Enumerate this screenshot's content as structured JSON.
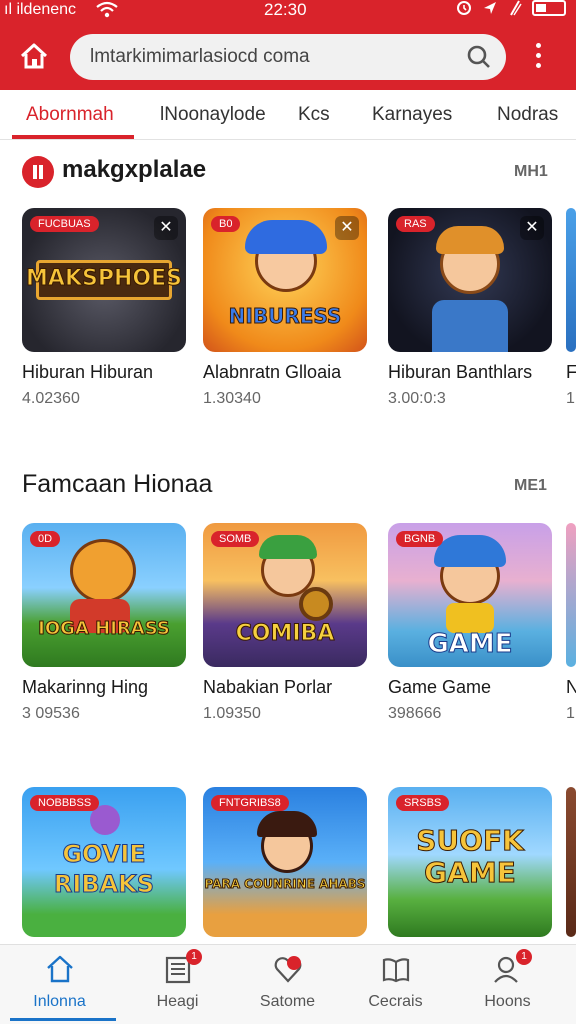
{
  "statusbar": {
    "carrier": "ıl ildenenc",
    "time": "22:30"
  },
  "browser": {
    "url": "lmtarkimimarlasiocd coma",
    "icons": [
      "home-icon",
      "search-icon",
      "more-vert-icon"
    ]
  },
  "tabs": [
    {
      "label": "Abornmah",
      "active": true
    },
    {
      "label": "lNoonaylode",
      "active": false
    },
    {
      "label": "Kcs",
      "active": false
    },
    {
      "label": "Karnayes",
      "active": false
    },
    {
      "label": "Nodras",
      "active": false
    }
  ],
  "sections": [
    {
      "title": "makgxplalae",
      "more": "MH1",
      "cards": [
        {
          "badge": "FUCBUAS",
          "art": "MAKSPHOES",
          "title": "Hiburan Hiburan",
          "sub": "4.02360",
          "closable": true
        },
        {
          "badge": "B0",
          "art": "NIBURESS",
          "title": "Alabnratn Glloaia",
          "sub": "1.30340",
          "closable": true
        },
        {
          "badge": "RAS",
          "art": "",
          "title": "Hiburan Banthlars",
          "sub": "3.00:0:3",
          "closable": true
        },
        {
          "badge": "",
          "art": "",
          "title": "F",
          "sub": "1",
          "closable": false
        }
      ]
    },
    {
      "title": "Famcaan Hionaa",
      "more": "ME1",
      "cards": [
        {
          "badge": "0D",
          "art": "IOGA HIRASS",
          "title": "Makarinng Hing",
          "sub": "3 09536",
          "closable": false
        },
        {
          "badge": "SOMB",
          "art": "COMIBA",
          "title": "Nabakian Porlar",
          "sub": "1.09350",
          "closable": false
        },
        {
          "badge": "BGNB",
          "art": "GAME",
          "title": "Game Game",
          "sub": "398666",
          "closable": false
        },
        {
          "badge": "",
          "art": "",
          "title": "N",
          "sub": "1",
          "closable": false
        }
      ]
    },
    {
      "title": "",
      "more": "",
      "cards": [
        {
          "badge": "NOBBBSS",
          "art": "GOVIE RIBAKS",
          "title": "",
          "sub": "",
          "closable": false
        },
        {
          "badge": "FNTGRIBS8",
          "art": "PARA COUNRINE AHABS",
          "title": "",
          "sub": "",
          "closable": false
        },
        {
          "badge": "SRSBS",
          "art": "SUOFK GAME",
          "title": "",
          "sub": "",
          "closable": false
        },
        {
          "badge": "",
          "art": "",
          "title": "",
          "sub": "",
          "closable": false
        }
      ]
    }
  ],
  "bottom_nav": [
    {
      "label": "Inlonna",
      "icon": "home-icon",
      "active": true,
      "badge": ""
    },
    {
      "label": "Heagi",
      "icon": "news-icon",
      "active": false,
      "badge": "1"
    },
    {
      "label": "Satome",
      "icon": "heart-icon",
      "active": false,
      "badge": ""
    },
    {
      "label": "Cecrais",
      "icon": "book-icon",
      "active": false,
      "badge": ""
    },
    {
      "label": "Hoons",
      "icon": "profile-icon",
      "active": false,
      "badge": "1"
    }
  ],
  "colors": {
    "brand_red": "#d9232b",
    "nav_active": "#1a73c8"
  }
}
